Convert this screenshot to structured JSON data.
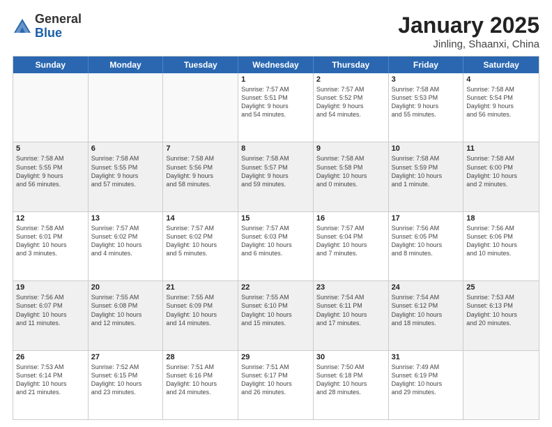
{
  "header": {
    "logo_general": "General",
    "logo_blue": "Blue",
    "title": "January 2025",
    "subtitle": "Jinling, Shaanxi, China"
  },
  "weekdays": [
    "Sunday",
    "Monday",
    "Tuesday",
    "Wednesday",
    "Thursday",
    "Friday",
    "Saturday"
  ],
  "rows": [
    {
      "alt": false,
      "cells": [
        {
          "day": "",
          "info": ""
        },
        {
          "day": "",
          "info": ""
        },
        {
          "day": "",
          "info": ""
        },
        {
          "day": "1",
          "info": "Sunrise: 7:57 AM\nSunset: 5:51 PM\nDaylight: 9 hours\nand 54 minutes."
        },
        {
          "day": "2",
          "info": "Sunrise: 7:57 AM\nSunset: 5:52 PM\nDaylight: 9 hours\nand 54 minutes."
        },
        {
          "day": "3",
          "info": "Sunrise: 7:58 AM\nSunset: 5:53 PM\nDaylight: 9 hours\nand 55 minutes."
        },
        {
          "day": "4",
          "info": "Sunrise: 7:58 AM\nSunset: 5:54 PM\nDaylight: 9 hours\nand 56 minutes."
        }
      ]
    },
    {
      "alt": true,
      "cells": [
        {
          "day": "5",
          "info": "Sunrise: 7:58 AM\nSunset: 5:55 PM\nDaylight: 9 hours\nand 56 minutes."
        },
        {
          "day": "6",
          "info": "Sunrise: 7:58 AM\nSunset: 5:55 PM\nDaylight: 9 hours\nand 57 minutes."
        },
        {
          "day": "7",
          "info": "Sunrise: 7:58 AM\nSunset: 5:56 PM\nDaylight: 9 hours\nand 58 minutes."
        },
        {
          "day": "8",
          "info": "Sunrise: 7:58 AM\nSunset: 5:57 PM\nDaylight: 9 hours\nand 59 minutes."
        },
        {
          "day": "9",
          "info": "Sunrise: 7:58 AM\nSunset: 5:58 PM\nDaylight: 10 hours\nand 0 minutes."
        },
        {
          "day": "10",
          "info": "Sunrise: 7:58 AM\nSunset: 5:59 PM\nDaylight: 10 hours\nand 1 minute."
        },
        {
          "day": "11",
          "info": "Sunrise: 7:58 AM\nSunset: 6:00 PM\nDaylight: 10 hours\nand 2 minutes."
        }
      ]
    },
    {
      "alt": false,
      "cells": [
        {
          "day": "12",
          "info": "Sunrise: 7:58 AM\nSunset: 6:01 PM\nDaylight: 10 hours\nand 3 minutes."
        },
        {
          "day": "13",
          "info": "Sunrise: 7:57 AM\nSunset: 6:02 PM\nDaylight: 10 hours\nand 4 minutes."
        },
        {
          "day": "14",
          "info": "Sunrise: 7:57 AM\nSunset: 6:02 PM\nDaylight: 10 hours\nand 5 minutes."
        },
        {
          "day": "15",
          "info": "Sunrise: 7:57 AM\nSunset: 6:03 PM\nDaylight: 10 hours\nand 6 minutes."
        },
        {
          "day": "16",
          "info": "Sunrise: 7:57 AM\nSunset: 6:04 PM\nDaylight: 10 hours\nand 7 minutes."
        },
        {
          "day": "17",
          "info": "Sunrise: 7:56 AM\nSunset: 6:05 PM\nDaylight: 10 hours\nand 8 minutes."
        },
        {
          "day": "18",
          "info": "Sunrise: 7:56 AM\nSunset: 6:06 PM\nDaylight: 10 hours\nand 10 minutes."
        }
      ]
    },
    {
      "alt": true,
      "cells": [
        {
          "day": "19",
          "info": "Sunrise: 7:56 AM\nSunset: 6:07 PM\nDaylight: 10 hours\nand 11 minutes."
        },
        {
          "day": "20",
          "info": "Sunrise: 7:55 AM\nSunset: 6:08 PM\nDaylight: 10 hours\nand 12 minutes."
        },
        {
          "day": "21",
          "info": "Sunrise: 7:55 AM\nSunset: 6:09 PM\nDaylight: 10 hours\nand 14 minutes."
        },
        {
          "day": "22",
          "info": "Sunrise: 7:55 AM\nSunset: 6:10 PM\nDaylight: 10 hours\nand 15 minutes."
        },
        {
          "day": "23",
          "info": "Sunrise: 7:54 AM\nSunset: 6:11 PM\nDaylight: 10 hours\nand 17 minutes."
        },
        {
          "day": "24",
          "info": "Sunrise: 7:54 AM\nSunset: 6:12 PM\nDaylight: 10 hours\nand 18 minutes."
        },
        {
          "day": "25",
          "info": "Sunrise: 7:53 AM\nSunset: 6:13 PM\nDaylight: 10 hours\nand 20 minutes."
        }
      ]
    },
    {
      "alt": false,
      "cells": [
        {
          "day": "26",
          "info": "Sunrise: 7:53 AM\nSunset: 6:14 PM\nDaylight: 10 hours\nand 21 minutes."
        },
        {
          "day": "27",
          "info": "Sunrise: 7:52 AM\nSunset: 6:15 PM\nDaylight: 10 hours\nand 23 minutes."
        },
        {
          "day": "28",
          "info": "Sunrise: 7:51 AM\nSunset: 6:16 PM\nDaylight: 10 hours\nand 24 minutes."
        },
        {
          "day": "29",
          "info": "Sunrise: 7:51 AM\nSunset: 6:17 PM\nDaylight: 10 hours\nand 26 minutes."
        },
        {
          "day": "30",
          "info": "Sunrise: 7:50 AM\nSunset: 6:18 PM\nDaylight: 10 hours\nand 28 minutes."
        },
        {
          "day": "31",
          "info": "Sunrise: 7:49 AM\nSunset: 6:19 PM\nDaylight: 10 hours\nand 29 minutes."
        },
        {
          "day": "",
          "info": ""
        }
      ]
    }
  ]
}
